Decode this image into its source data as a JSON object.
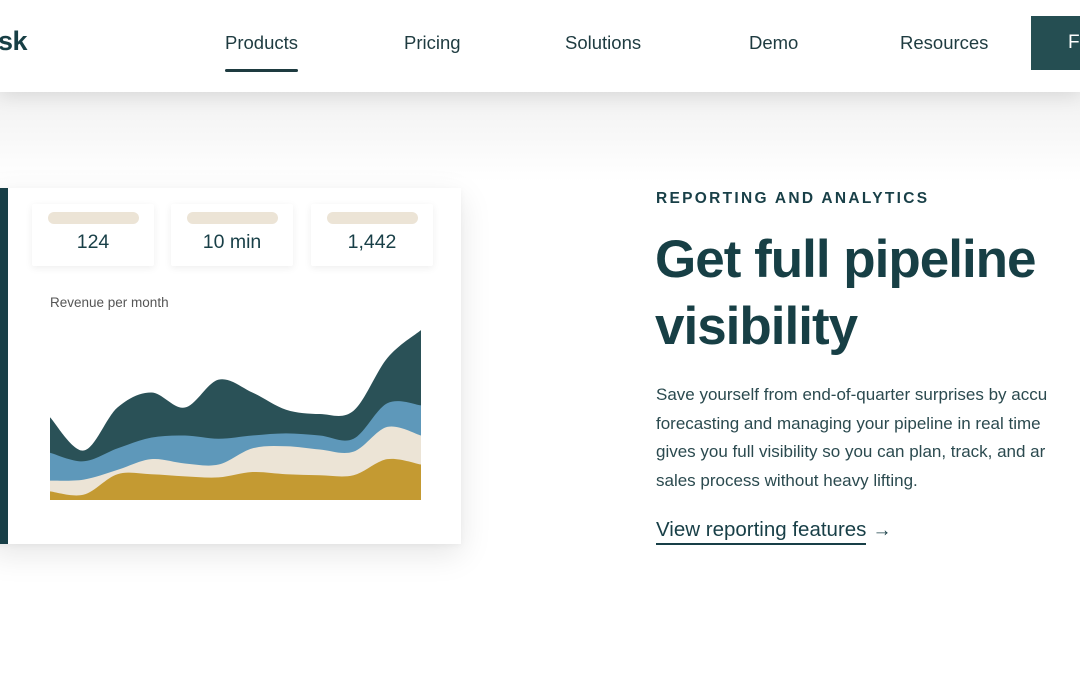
{
  "header": {
    "logo_fragment": "sk",
    "nav": [
      {
        "label": "Products",
        "active": true
      },
      {
        "label": "Pricing",
        "active": false
      },
      {
        "label": "Solutions",
        "active": false
      },
      {
        "label": "Demo",
        "active": false
      },
      {
        "label": "Resources",
        "active": false
      }
    ],
    "cta_label_fragment": "F"
  },
  "card": {
    "stats": [
      {
        "value": "124"
      },
      {
        "value": "10 min"
      },
      {
        "value": "1,442"
      }
    ],
    "chart_title": "Revenue per month"
  },
  "content": {
    "eyebrow": "REPORTING AND ANALYTICS",
    "headline_lines": [
      "Get full pipeline",
      "visibility"
    ],
    "body_lines": [
      "Save yourself from end-of-quarter surprises by accu",
      "forecasting and managing your pipeline in real time",
      "gives you full visibility so you can plan, track, and ar",
      "sales process without heavy lifting."
    ],
    "link_label": "View reporting features",
    "link_arrow": "→"
  },
  "colors": {
    "brand_dark": "#173f45",
    "cta_bg": "#254e52",
    "series_dark": "#2a5157",
    "series_blue": "#5e98ba",
    "series_cream": "#ece4d6",
    "series_gold": "#c49a32"
  },
  "chart_data": {
    "type": "area",
    "stacked": true,
    "title": "Revenue per month",
    "xlabel": "",
    "ylabel": "",
    "x": [
      1,
      2,
      3,
      4,
      5,
      6,
      7,
      8,
      9,
      10,
      11,
      12
    ],
    "ylim": [
      0,
      160
    ],
    "grid": false,
    "legend": "none",
    "series": [
      {
        "name": "gold",
        "color": "#c49a32",
        "values": [
          8,
          5,
          24,
          24,
          22,
          21,
          26,
          24,
          23,
          23,
          38,
          33
        ]
      },
      {
        "name": "cream",
        "color": "#ece4d6",
        "values": [
          10,
          14,
          4,
          14,
          12,
          12,
          22,
          26,
          24,
          22,
          30,
          27
        ]
      },
      {
        "name": "blue",
        "color": "#5e98ba",
        "values": [
          26,
          17,
          20,
          20,
          26,
          24,
          12,
          12,
          13,
          12,
          22,
          28
        ]
      },
      {
        "name": "dark",
        "color": "#2a5157",
        "values": [
          33,
          10,
          38,
          42,
          26,
          55,
          40,
          22,
          20,
          26,
          42,
          70
        ]
      }
    ]
  }
}
